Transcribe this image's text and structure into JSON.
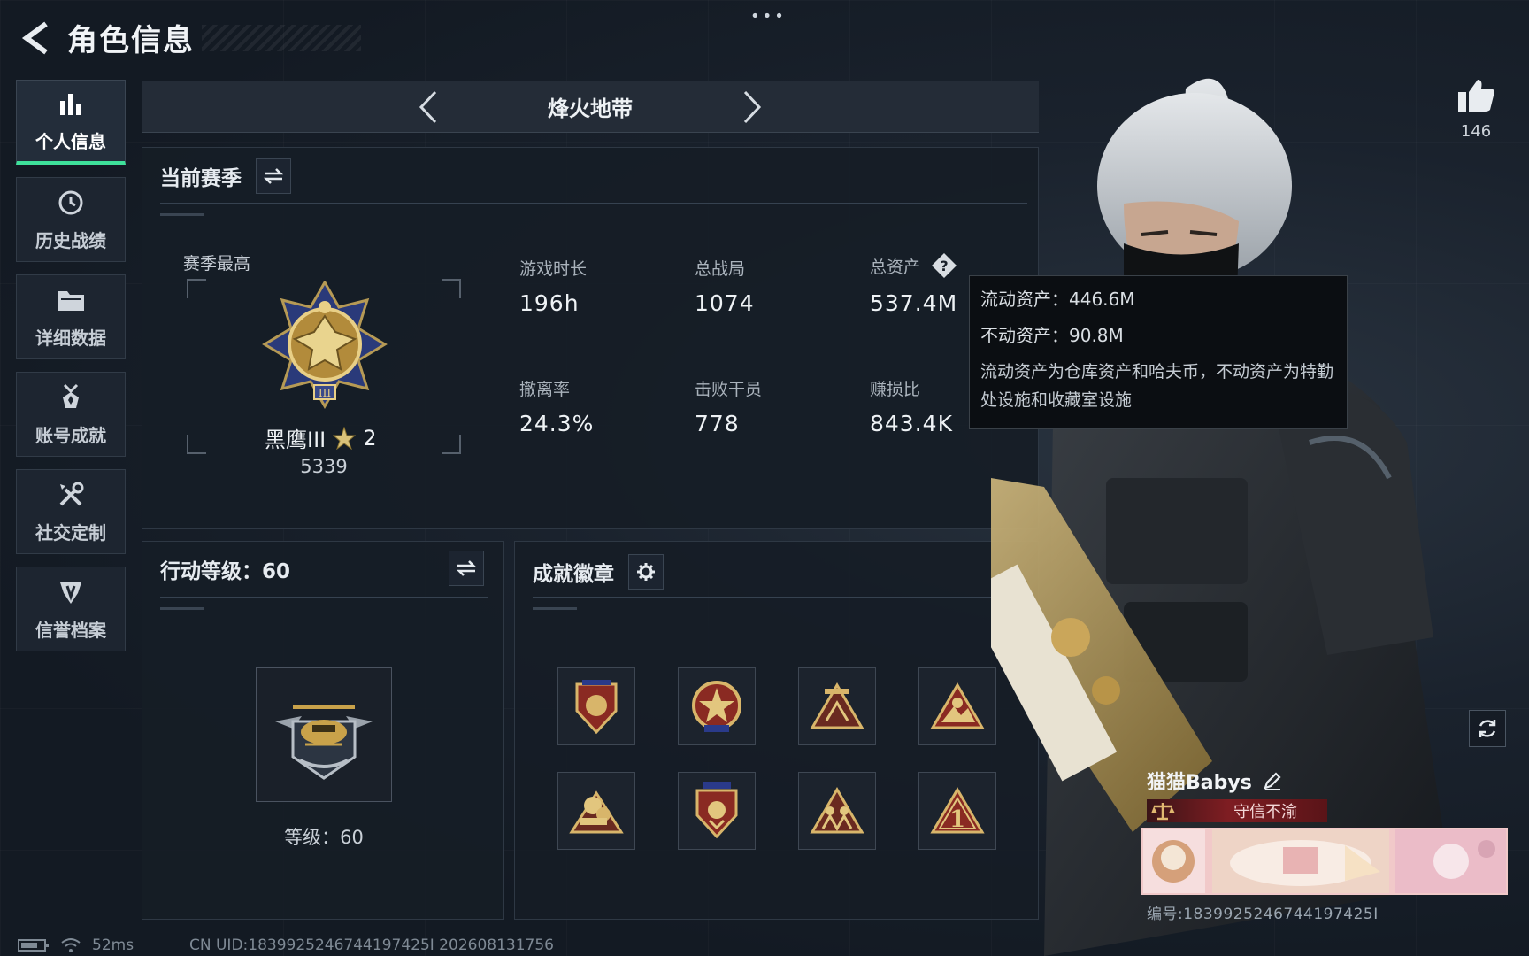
{
  "header": {
    "title": "角色信息"
  },
  "sidebar": {
    "items": [
      {
        "label": "个人信息",
        "icon": "bar-chart-icon",
        "active": true
      },
      {
        "label": "历史战绩",
        "icon": "clock-history-icon",
        "active": false
      },
      {
        "label": "详细数据",
        "icon": "folder-icon",
        "active": false
      },
      {
        "label": "账号成就",
        "icon": "medal-icon",
        "active": false
      },
      {
        "label": "社交定制",
        "icon": "tools-icon",
        "active": false
      },
      {
        "label": "信誉档案",
        "icon": "shield-badge-icon",
        "active": false
      }
    ]
  },
  "mode": {
    "name": "烽火地带"
  },
  "season": {
    "title": "当前赛季",
    "peak_label": "赛季最高",
    "rank_name": "黑鹰III",
    "rank_stars": "2",
    "rank_points": "5339",
    "stats": [
      {
        "label": "游戏时长",
        "value": "196h"
      },
      {
        "label": "总战局",
        "value": "1074"
      },
      {
        "label": "总资产",
        "value": "537.4M"
      },
      {
        "label": "撤离率",
        "value": "24.3%"
      },
      {
        "label": "击败干员",
        "value": "778"
      },
      {
        "label": "赚损比",
        "value": "843.4K"
      }
    ]
  },
  "tooltip": {
    "liquid": "流动资产：446.6M",
    "fixed": "不动资产：90.8M",
    "desc": "流动资产为仓库资产和哈夫币，不动资产为特勤处设施和收藏室设施"
  },
  "action_level": {
    "title": "行动等级：60",
    "level_text": "等级：60"
  },
  "achievements": {
    "title": "成就徽章",
    "badges": [
      "shield-badge-icon",
      "star-emblem-icon",
      "camp-triangle-icon",
      "mountain-triangle-icon",
      "cargo-badge-icon",
      "crest-badge-icon",
      "squad-triangle-icon",
      "number-one-triangle-icon"
    ]
  },
  "like": {
    "count": "146"
  },
  "player": {
    "name": "猫猫Babys",
    "title": "守信不渝",
    "uid": "编号:1839925246744197425I"
  },
  "status_bar": {
    "ping": "52ms",
    "uid": "CN UID:1839925246744197425I 202608131756"
  },
  "colors": {
    "accent": "#3ee09a",
    "background": "#151c26",
    "title_badge_red": "#7e1d22",
    "gold": "#c9a24a"
  }
}
